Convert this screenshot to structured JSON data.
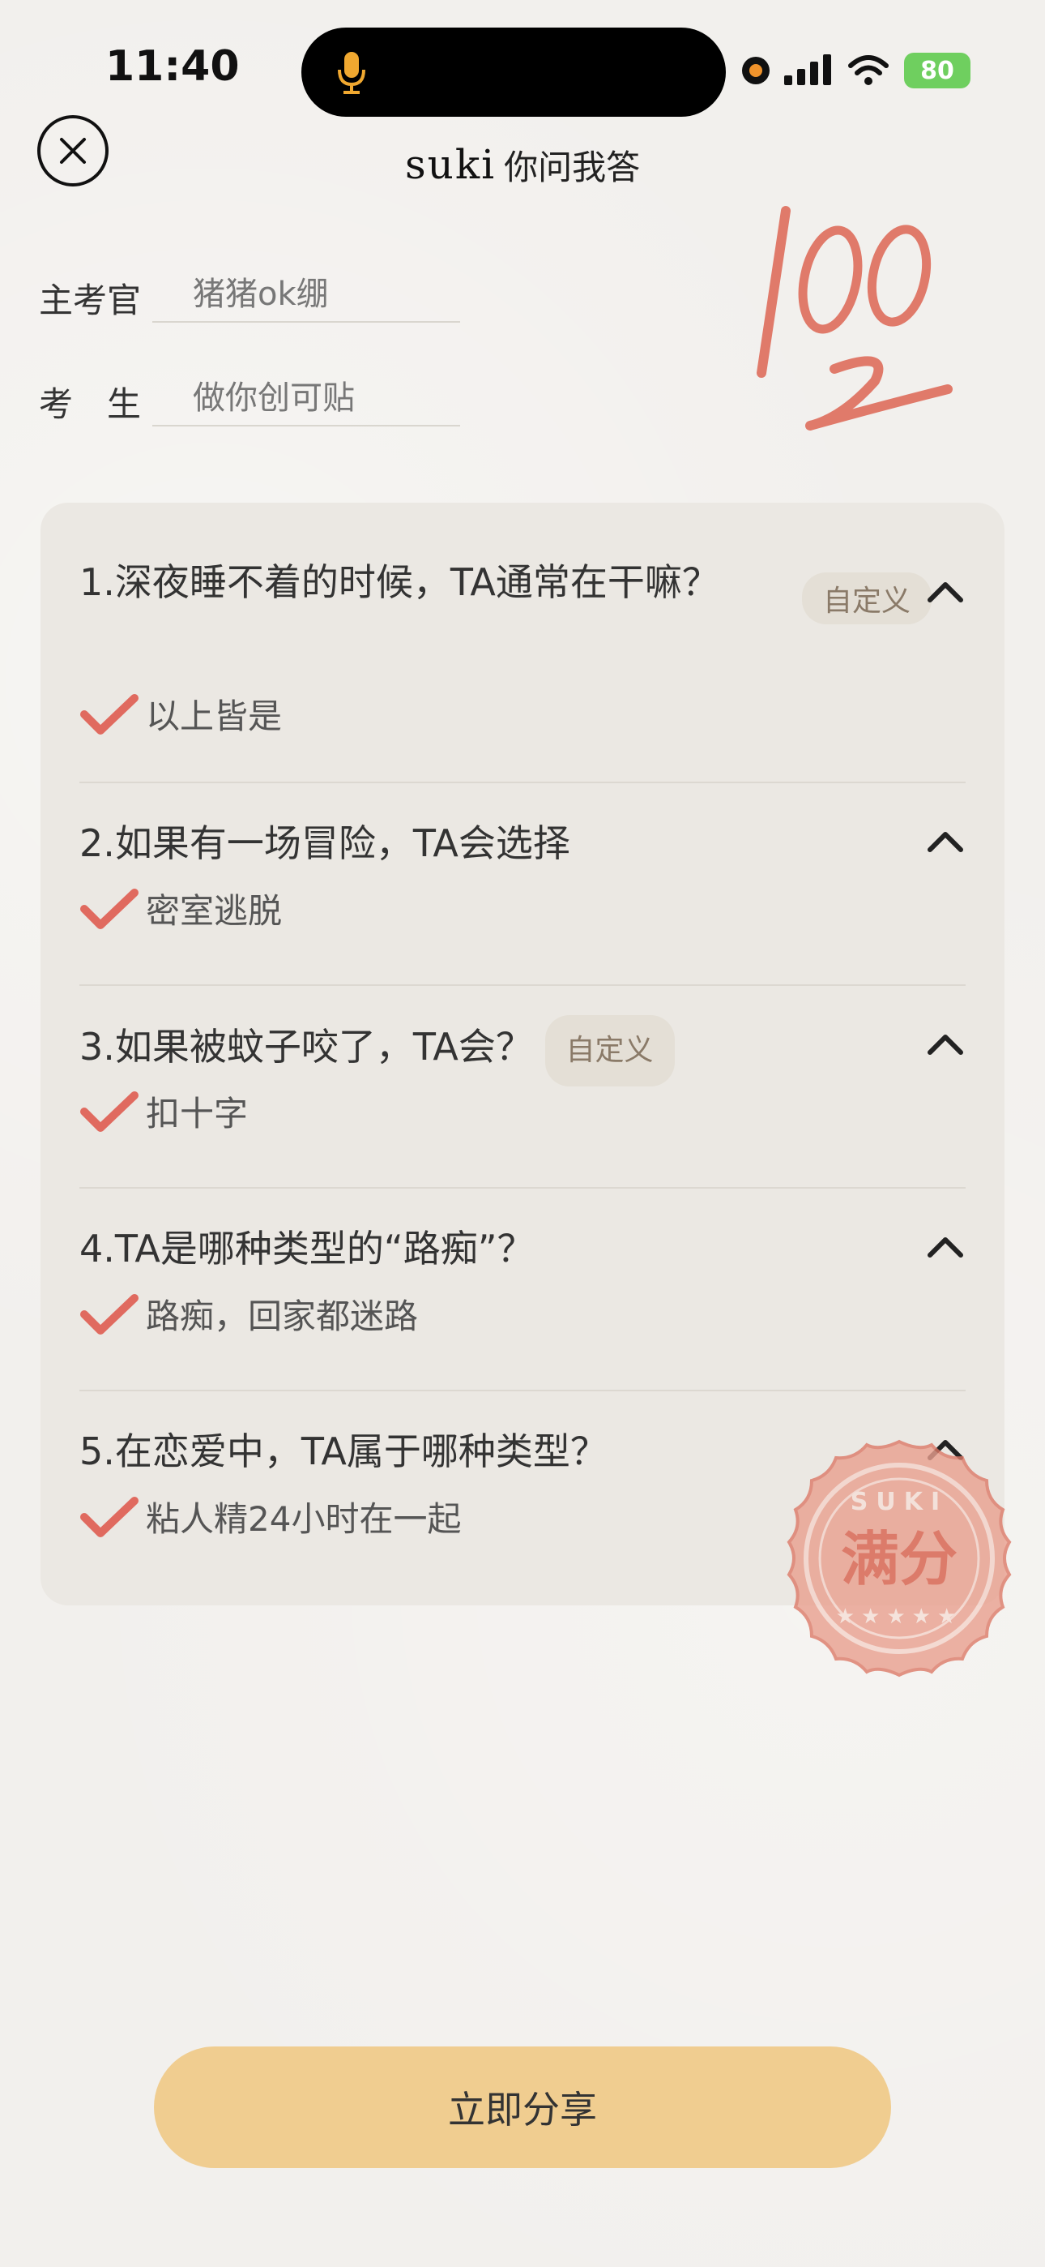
{
  "status_bar": {
    "time": "11:40",
    "battery": "80"
  },
  "header": {
    "brand": "suki",
    "title": "你问我答"
  },
  "form": {
    "examiner_label": "主考官",
    "examiner_value": "猪猪ok绷",
    "examinee_label": "考　生",
    "examinee_value": "做你创可贴"
  },
  "score": "100",
  "questions": [
    {
      "title": "1.深夜睡不着的时候，TA通常在干嘛？",
      "tag": "自定义",
      "answer": "以上皆是"
    },
    {
      "title": "2.如果有一场冒险，TA会选择",
      "tag": "",
      "answer": "密室逃脱"
    },
    {
      "title": "3.如果被蚊子咬了，TA会？",
      "tag": "自定义",
      "answer": "扣十字"
    },
    {
      "title": "4.TA是哪种类型的“路痴”？",
      "tag": "",
      "answer": "路痴，回家都迷路"
    },
    {
      "title": "5.在恋爱中，TA属于哪种类型？",
      "tag": "",
      "answer": "粘人精24小时在一起"
    }
  ],
  "stamp": {
    "brand": "SUKI",
    "text": "满分"
  },
  "share_button": "立即分享",
  "colors": {
    "accent_red": "#e06a5f",
    "share_button": "#f0cd90",
    "card_bg": "#ebe8e3"
  }
}
